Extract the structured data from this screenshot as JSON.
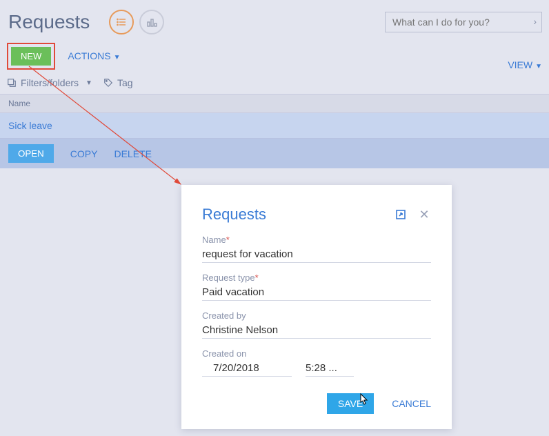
{
  "page": {
    "title": "Requests"
  },
  "search": {
    "placeholder": "What can I do for you?"
  },
  "toolbar": {
    "new_label": "NEW",
    "actions_label": "ACTIONS",
    "view_label": "VIEW"
  },
  "filters": {
    "filters_folders_label": "Filters/folders",
    "tag_label": "Tag"
  },
  "grid": {
    "columns": {
      "name": "Name"
    },
    "rows": [
      {
        "name": "Sick leave"
      }
    ],
    "row_actions": {
      "open": "OPEN",
      "copy": "COPY",
      "delete": "DELETE"
    }
  },
  "dialog": {
    "title": "Requests",
    "fields": {
      "name": {
        "label": "Name",
        "value": "request for vacation",
        "required": true
      },
      "request_type": {
        "label": "Request type",
        "value": "Paid vacation",
        "required": true
      },
      "created_by": {
        "label": "Created by",
        "value": "Christine Nelson"
      },
      "created_on": {
        "label": "Created on",
        "date": "7/20/2018",
        "time": "5:28 ..."
      }
    },
    "buttons": {
      "save": "SAVE",
      "cancel": "CANCEL"
    }
  }
}
